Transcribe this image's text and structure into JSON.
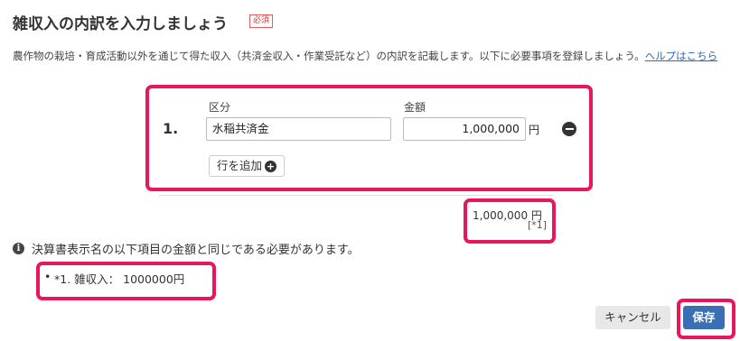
{
  "header": {
    "title": "雑収入の内訳を入力しましょう",
    "required_badge": "必須"
  },
  "description": {
    "text": "農作物の栽培・育成活動以外を通じて得た収入（共済金収入・作業受託など）の内訳を記載します。以下に必要事項を登録しましょう。",
    "help_link": "ヘルプはこちら"
  },
  "form": {
    "category_label": "区分",
    "amount_label": "金額",
    "rows": [
      {
        "number": "1.",
        "category": "水稲共済金",
        "amount": "1,000,000",
        "unit": "円"
      }
    ],
    "add_row_label": "行を追加"
  },
  "total": {
    "amount": "1,000,000",
    "unit": "円",
    "note": "[*1]"
  },
  "notice": {
    "text": "決算書表示名の以下項目の金額と同じである必要があります。",
    "items": [
      "*1. 雑収入： 1000000円"
    ]
  },
  "footer": {
    "cancel_label": "キャンセル",
    "save_label": "保存"
  },
  "colors": {
    "highlight": "#e8175d",
    "primary": "#3a6fb5",
    "link": "#2a6bd1"
  }
}
